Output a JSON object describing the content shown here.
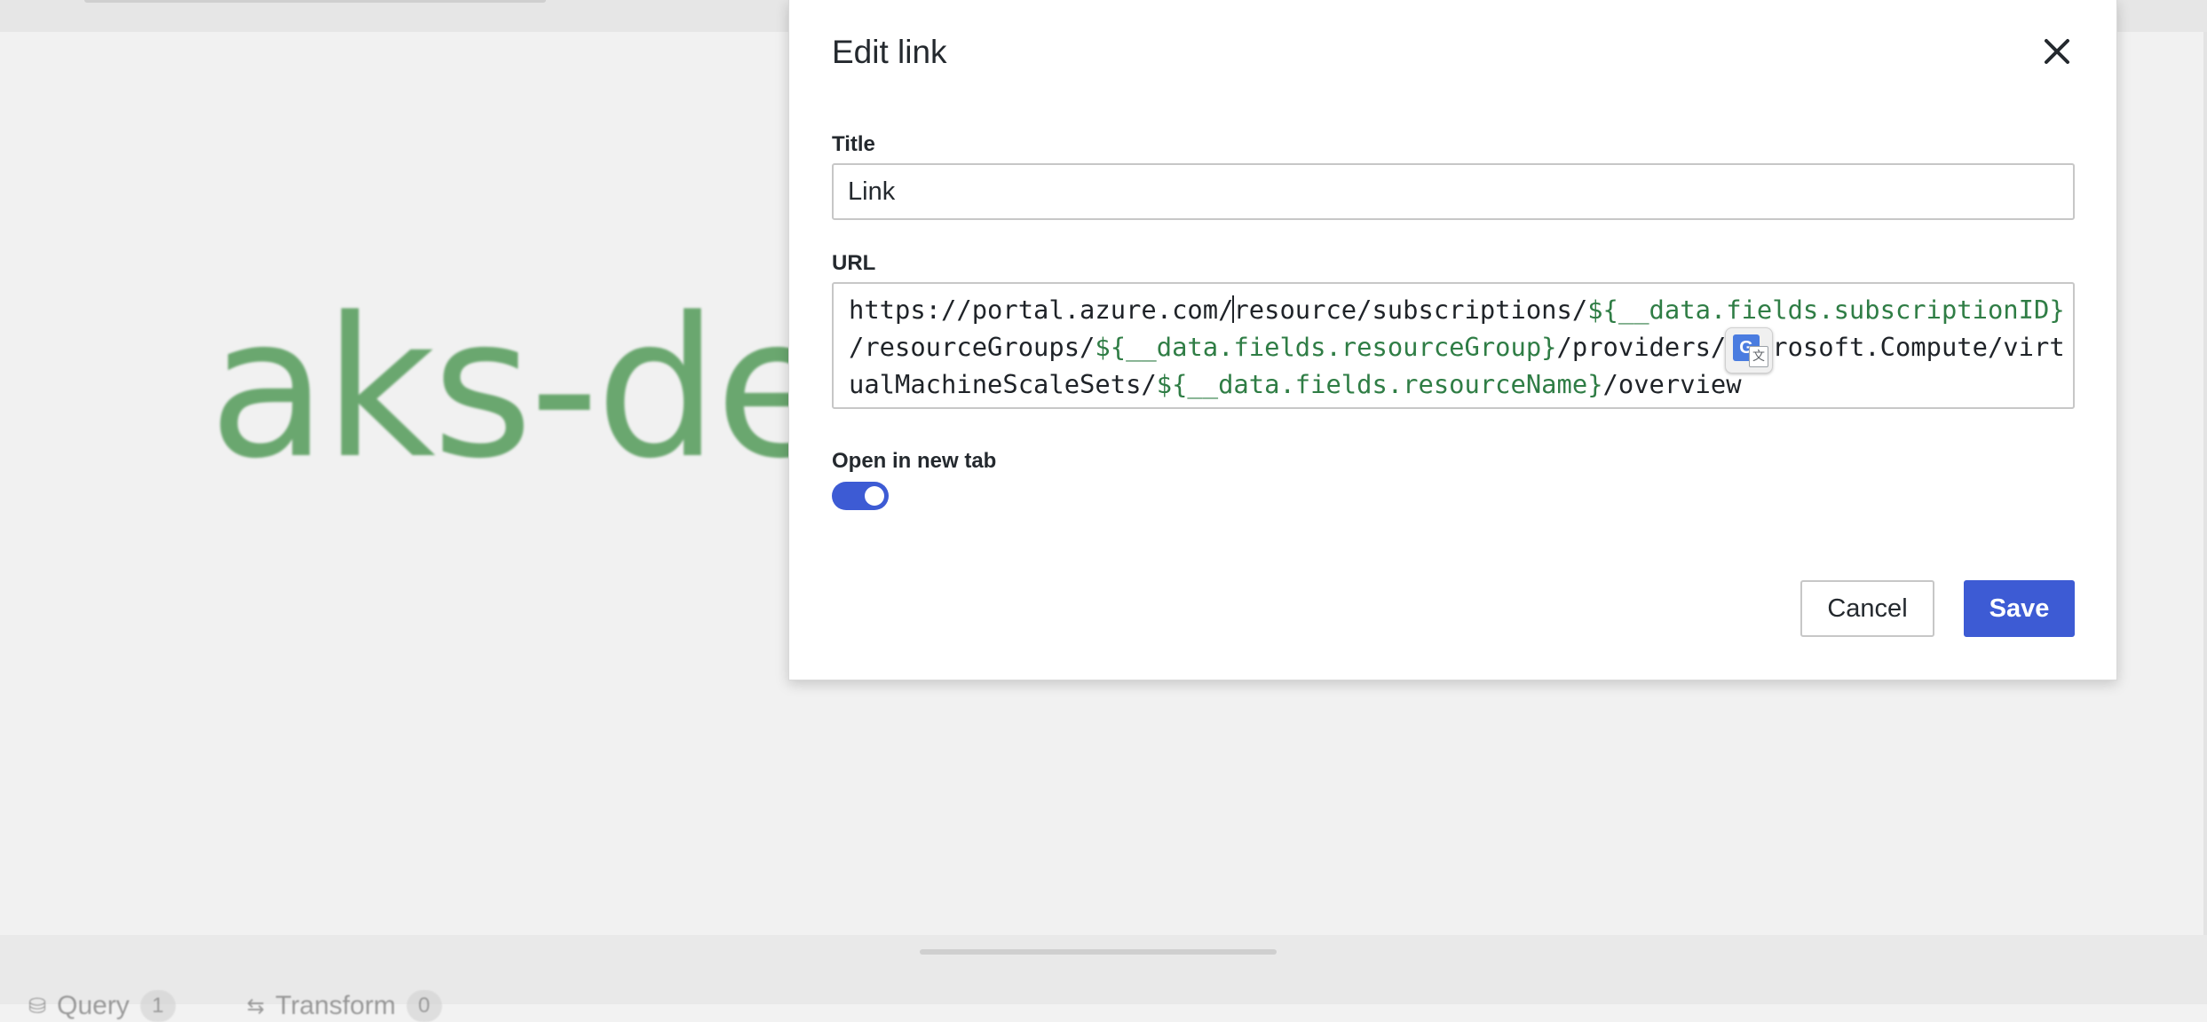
{
  "background": {
    "stat_value": "aks-def",
    "bottom_tabs": [
      {
        "label": "Query",
        "count": "1",
        "icon": "database-icon"
      },
      {
        "label": "Transform",
        "count": "0",
        "icon": "transform-icon"
      }
    ]
  },
  "dialog": {
    "title": "Edit link",
    "close_icon": "close-icon",
    "title_field": {
      "label": "Title",
      "value": "Link"
    },
    "url_field": {
      "label": "URL",
      "lines": [
        [
          {
            "text": "https://portal.azure.com/",
            "var": false
          },
          {
            "text": "resource/subscriptions/",
            "var": false
          },
          {
            "text": "${__data.fields.subscriptionID}",
            "var": true
          }
        ],
        [
          {
            "text": "/resourceGroups/",
            "var": false
          },
          {
            "text": "${__data.fields.resourceGroup}",
            "var": true
          },
          {
            "text": "/providers/Microsoft.Compute/virt",
            "var": false
          }
        ],
        [
          {
            "text": "ualMachineScaleSets/",
            "var": false
          },
          {
            "text": "${__data.fields.resourceName}",
            "var": true
          },
          {
            "text": "/overview",
            "var": false
          }
        ]
      ]
    },
    "open_in_new_tab": {
      "label": "Open in new tab",
      "enabled": true
    },
    "buttons": {
      "cancel": "Cancel",
      "save": "Save"
    }
  },
  "translate_badge": {
    "glyph": "G",
    "doc_glyph": "文",
    "icon": "google-translate-icon"
  },
  "colors": {
    "accent": "#3d5bd4",
    "template_variable": "#2f7d45",
    "stat_value": "#6aa76f"
  }
}
